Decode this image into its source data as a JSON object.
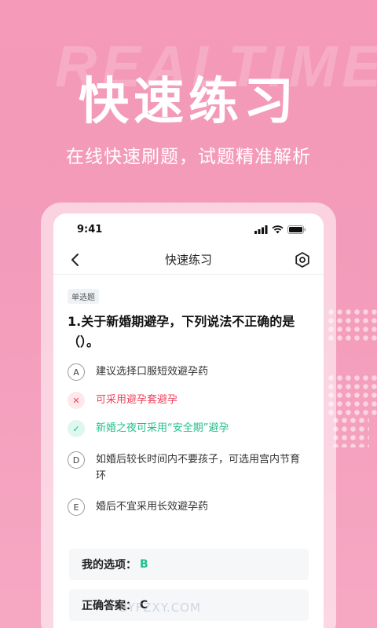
{
  "hero": {
    "bg_word": "REALTIME",
    "title": "快速练习",
    "subtitle": "在线快速刷题，试题精准解析"
  },
  "status_bar": {
    "time": "9:41"
  },
  "nav": {
    "title": "快速练习"
  },
  "question": {
    "type_tag": "单选题",
    "text": "1.关于新婚期避孕，下列说法不正确的是（）。",
    "options": [
      {
        "letter": "A",
        "text": "建议选择口服短效避孕药",
        "state": "normal"
      },
      {
        "letter": "✕",
        "text": "可采用避孕套避孕",
        "state": "wrong"
      },
      {
        "letter": "✓",
        "text": "新婚之夜可采用“安全期”避孕",
        "state": "right"
      },
      {
        "letter": "D",
        "text": "如婚后较长时间内不要孩子，可选用宫内节育环",
        "state": "normal"
      },
      {
        "letter": "E",
        "text": "婚后不宜采用长效避孕药",
        "state": "normal"
      }
    ]
  },
  "answers": {
    "mine_label": "我的选项：",
    "mine_value": "B",
    "correct_label": "正确答案：",
    "correct_value": "C"
  },
  "watermark": "BYFZXY.COM",
  "colors": {
    "wrong": "#f0435c",
    "right": "#20c08a",
    "brand_pink": "#f59ab8"
  }
}
